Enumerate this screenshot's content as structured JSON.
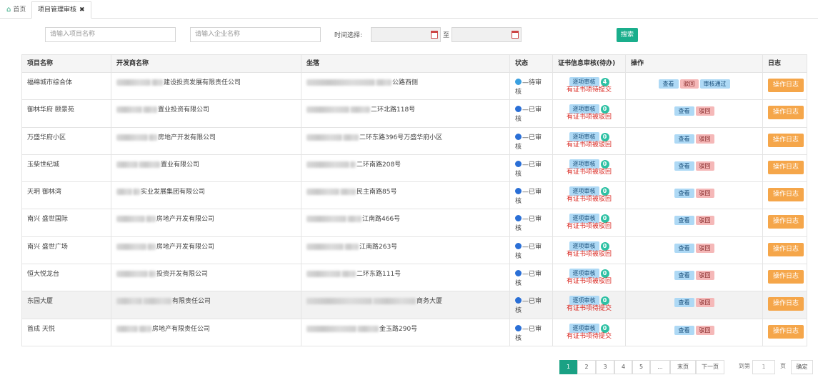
{
  "tabs": {
    "home": "首页",
    "active": "项目管理审核",
    "close": "✖"
  },
  "filters": {
    "project_placeholder": "请输入项目名称",
    "company_placeholder": "请输入企业名称",
    "time_label": "时间选择:",
    "to_label": "至",
    "search_label": "搜索"
  },
  "table": {
    "headers": [
      "项目名称",
      "开发商名称",
      "坐落",
      "状态",
      "证书信息审核(待办)",
      "操作",
      "日志"
    ],
    "rows": [
      {
        "name": "福绵城市综合体",
        "dev_suffix": "建设投资发展有限责任公司",
        "addr_suffix": "公路西侧",
        "status": "待审核",
        "status_color": "#3aa0e0",
        "badge": "4",
        "note": "有证书项待提交",
        "pass": true
      },
      {
        "name": "御林华府 颐景苑",
        "dev_suffix": "置业投资有限公司",
        "addr_suffix": "二环北路118号",
        "status": "已审核",
        "status_color": "#2a6fd6",
        "badge": "0",
        "note": "有证书项被驳回",
        "pass": false
      },
      {
        "name": "万盛华府小区",
        "dev_suffix": "房地产开发有限公司",
        "addr_suffix": "二环东路396号万盛华府小区",
        "status": "已审核",
        "status_color": "#2a6fd6",
        "badge": "0",
        "note": "有证书项被驳回",
        "pass": false
      },
      {
        "name": "玉柴世纪城",
        "dev_suffix": "置业有限公司",
        "addr_suffix": "二环南路208号",
        "status": "已审核",
        "status_color": "#2a6fd6",
        "badge": "0",
        "note": "有证书项被驳回",
        "pass": false
      },
      {
        "name": "天玥 御林湾",
        "dev_suffix": "实业发展集团有限公司",
        "addr_suffix": "民主南路85号",
        "status": "已审核",
        "status_color": "#2a6fd6",
        "badge": "0",
        "note": "有证书项被驳回",
        "pass": false
      },
      {
        "name": "南兴 盛世国际",
        "dev_suffix": "房地产开发有限公司",
        "addr_suffix": "江南路466号",
        "status": "已审核",
        "status_color": "#2a6fd6",
        "badge": "0",
        "note": "有证书项被驳回",
        "pass": false
      },
      {
        "name": "南兴 盛世广场",
        "dev_suffix": "房地产开发有限公司",
        "addr_suffix": "江南路263号",
        "status": "已审核",
        "status_color": "#2a6fd6",
        "badge": "0",
        "note": "有证书项被驳回",
        "pass": false
      },
      {
        "name": "恒大悦龙台",
        "dev_suffix": "投资开发有限公司",
        "addr_suffix": "二环东路111号",
        "status": "已审核",
        "status_color": "#2a6fd6",
        "badge": "0",
        "note": "有证书项被驳回",
        "pass": false
      },
      {
        "name": "东园大厦",
        "dev_suffix": "有限责任公司",
        "addr_suffix": "商务大厦",
        "status": "已审核",
        "status_color": "#2a6fd6",
        "badge": "0",
        "note": "有证书项待提交",
        "pass": false
      },
      {
        "name": "首成 天悦",
        "dev_suffix": "房地产有限责任公司",
        "addr_suffix": "金玉路290号",
        "status": "已审核",
        "status_color": "#2a6fd6",
        "badge": "0",
        "note": "有证书项待提交",
        "pass": false
      }
    ],
    "btn_item_review": "逐项审核",
    "btn_view": "查看",
    "btn_reject": "驳回",
    "btn_pass": "审核通过",
    "btn_log": "操作日志"
  },
  "pager": {
    "pages": [
      "1",
      "2",
      "3",
      "4",
      "5"
    ],
    "current": "1",
    "ellipsis": "...",
    "last": "末页",
    "next": "下一页",
    "goto_label": "到第",
    "goto_value": "1",
    "page_unit": "页",
    "confirm": "确定"
  },
  "colors": {
    "accent": "#1aa184",
    "log": "#f5a64a",
    "warn": "#d9231c"
  }
}
